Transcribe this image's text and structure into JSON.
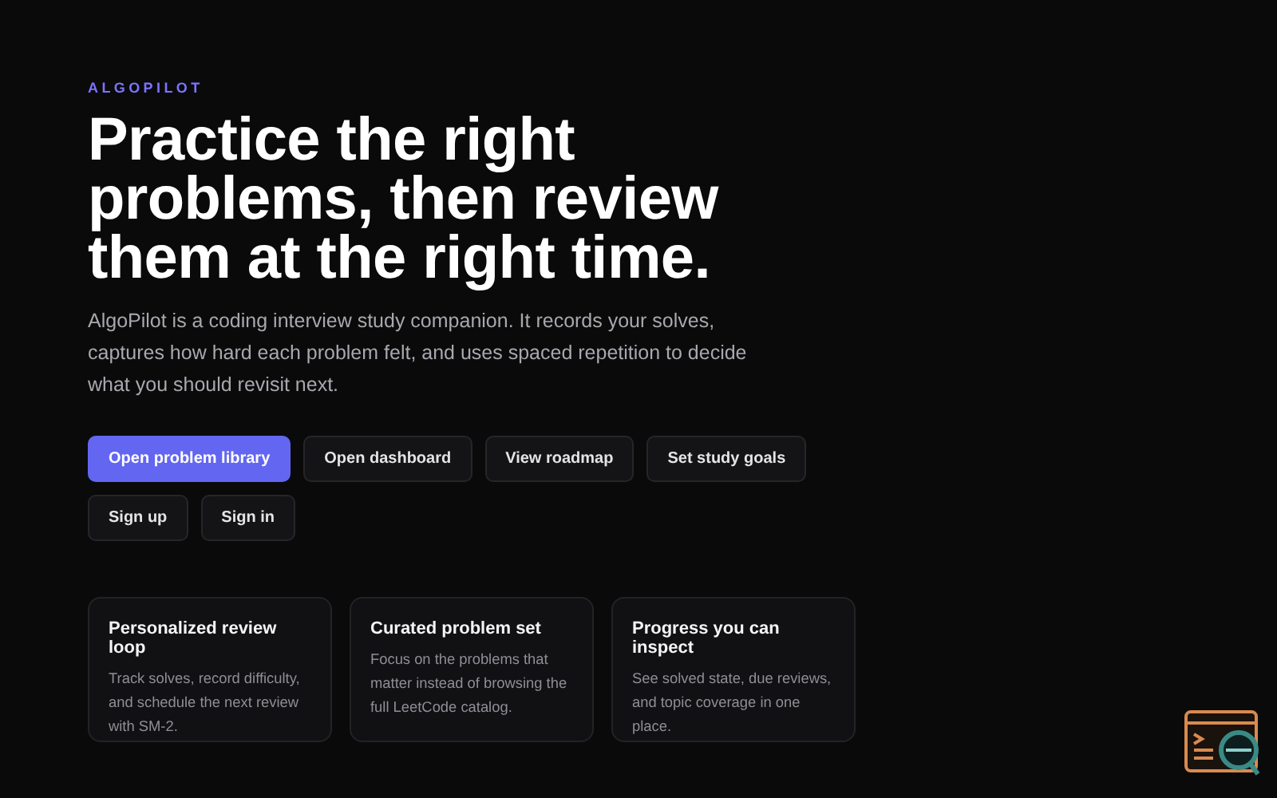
{
  "brand": "ALGOPILOT",
  "headline": "Practice the right problems, then review them at the right time.",
  "description": "AlgoPilot is a coding interview study companion. It records your solves, captures how hard each problem felt, and uses spaced repetition to decide what you should revisit next.",
  "button_rows": [
    [
      {
        "label": "Open problem library",
        "kind": "primary"
      },
      {
        "label": "Open dashboard",
        "kind": "secondary"
      },
      {
        "label": "View roadmap",
        "kind": "secondary"
      },
      {
        "label": "Set study goals",
        "kind": "secondary"
      }
    ],
    [
      {
        "label": "Sign up",
        "kind": "secondary"
      },
      {
        "label": "Sign in",
        "kind": "secondary"
      }
    ]
  ],
  "features": [
    {
      "title": "Personalized review loop",
      "text": "Track solves, record difficulty, and schedule the next review with SM-2."
    },
    {
      "title": "Curated problem set",
      "text": "Focus on the problems that matter instead of browsing the full LeetCode catalog."
    },
    {
      "title": "Progress you can inspect",
      "text": "See solved state, due reviews, and topic coverage in one place."
    }
  ]
}
